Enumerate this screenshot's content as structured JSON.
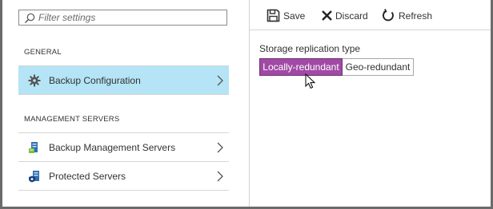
{
  "search": {
    "placeholder": "Filter settings",
    "value": ""
  },
  "sidebar": {
    "sections": [
      {
        "header": "GENERAL",
        "items": [
          {
            "label": "Backup Configuration",
            "icon": "gear-icon",
            "selected": true
          }
        ]
      },
      {
        "header": "MANAGEMENT SERVERS",
        "items": [
          {
            "label": "Backup Management Servers",
            "icon": "server-icon",
            "selected": false
          },
          {
            "label": "Protected Servers",
            "icon": "protected-server-icon",
            "selected": false
          }
        ]
      }
    ]
  },
  "toolbar": {
    "save_label": "Save",
    "discard_label": "Discard",
    "refresh_label": "Refresh"
  },
  "storage": {
    "label": "Storage replication type",
    "options": [
      "Locally-redundant",
      "Geo-redundant"
    ],
    "selected": "Locally-redundant"
  },
  "colors": {
    "selected_nav": "#b4e4f5",
    "selected_option": "#a04aa5",
    "frame": "#6b6b6b"
  }
}
